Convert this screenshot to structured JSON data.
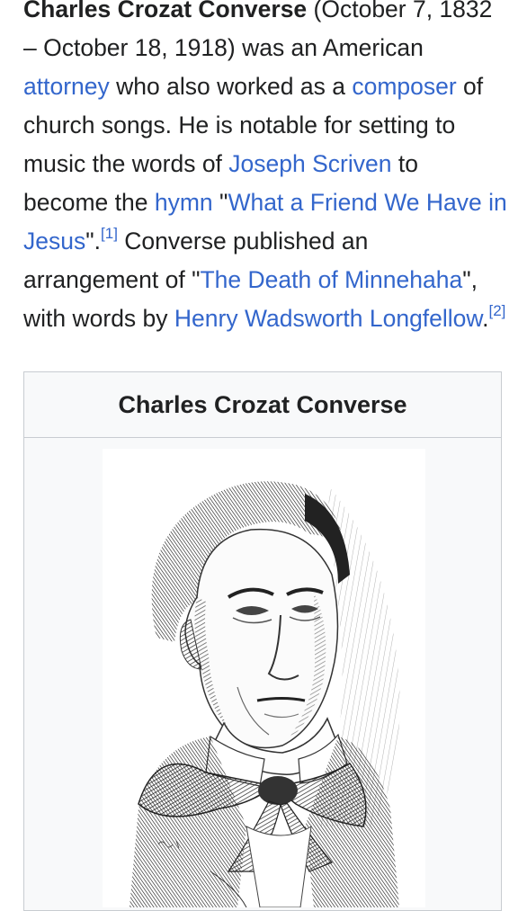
{
  "article": {
    "subject_name": "Charles Crozat Converse",
    "dates": " (October 7, 1832 – October 18, 1918) was an American ",
    "link_attorney": "attorney",
    "text_2": " who also worked as a ",
    "link_composer": "composer",
    "text_3": " of church songs. He is notable for setting to music the words of ",
    "link_scriven": "Joseph Scriven",
    "text_4": " to become the ",
    "link_hymn": "hymn",
    "text_5": " \"",
    "link_friend": "What a Friend We Have in Jesus",
    "text_6": "\".",
    "ref_1": "[1]",
    "text_7": " Converse published an arrangement of \"",
    "link_minnehaha": "The Death of Minnehaha",
    "text_8": "\", with words by ",
    "link_longfellow": "Henry Wadsworth Longfellow",
    "text_9": ".",
    "ref_2": "[2]"
  },
  "infobox": {
    "title": "Charles Crozat Converse"
  }
}
